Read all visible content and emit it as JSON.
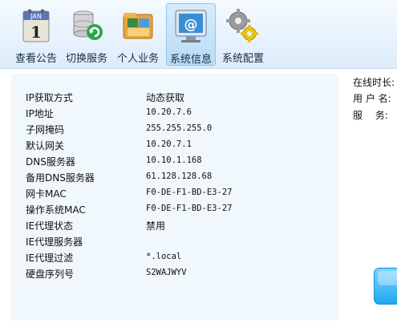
{
  "toolbar": {
    "items": [
      {
        "label": "查看公告",
        "icon": "calendar-icon"
      },
      {
        "label": "切换服务",
        "icon": "database-refresh-icon"
      },
      {
        "label": "个人业务",
        "icon": "folder-icon"
      },
      {
        "label": "系统信息",
        "icon": "monitor-at-icon",
        "active": true
      },
      {
        "label": "系统配置",
        "icon": "gears-icon"
      }
    ],
    "calendar_month": "JAN",
    "calendar_day": "1"
  },
  "info": {
    "rows": [
      {
        "key": "IP获取方式",
        "value": "动态获取"
      },
      {
        "key": "IP地址",
        "value": "10.20.7.6"
      },
      {
        "key": "子网掩码",
        "value": "255.255.255.0"
      },
      {
        "key": "默认网关",
        "value": "10.20.7.1"
      },
      {
        "key": "DNS服务器",
        "value": "10.10.1.168"
      },
      {
        "key": "备用DNS服务器",
        "value": "61.128.128.68"
      },
      {
        "key": "网卡MAC",
        "value": "F0-DE-F1-BD-E3-27"
      },
      {
        "key": "操作系统MAC",
        "value": "F0-DE-F1-BD-E3-27"
      },
      {
        "key": "IE代理状态",
        "value": "禁用"
      },
      {
        "key": "IE代理服务器",
        "value": ""
      },
      {
        "key": "IE代理过滤",
        "value": "*.local"
      },
      {
        "key": "硬盘序列号",
        "value": "S2WAJWYV"
      }
    ]
  },
  "side": {
    "online_label": "在线时长:",
    "user_label": "用 户 名:",
    "service_label": "服　 务:"
  },
  "colors": {
    "accent": "#1ea8ee",
    "panel": "#f1f8fd"
  }
}
